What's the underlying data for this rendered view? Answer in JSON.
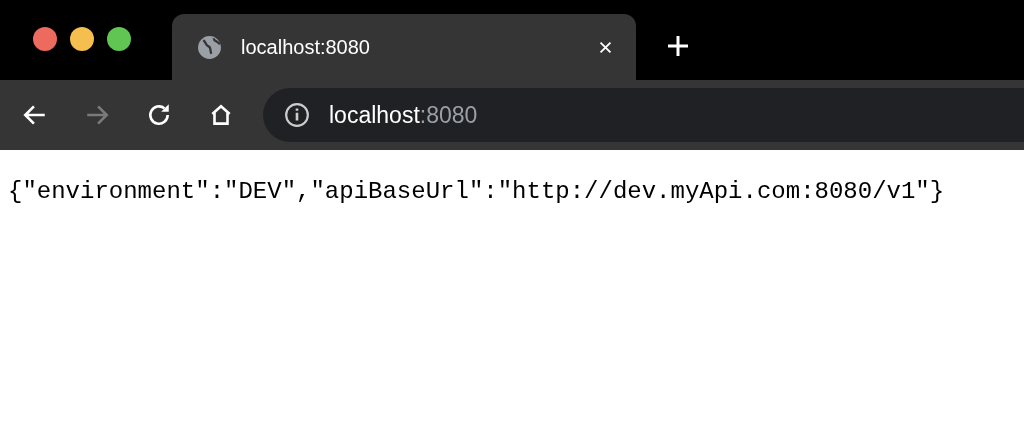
{
  "tabs": [
    {
      "title": "localhost:8080",
      "selected": true
    }
  ],
  "toolbar": {
    "buttons": [
      {
        "kind": "back",
        "disabled": false
      },
      {
        "kind": "forward",
        "disabled": true
      },
      {
        "kind": "reload",
        "disabled": false
      },
      {
        "kind": "home",
        "disabled": false
      }
    ]
  },
  "address": {
    "host": "localhost",
    "port": ":8080"
  },
  "page": {
    "text": "{\"environment\":\"DEV\",\"apiBaseUrl\":\"http://dev.myApi.com:8080/v1\"}"
  }
}
